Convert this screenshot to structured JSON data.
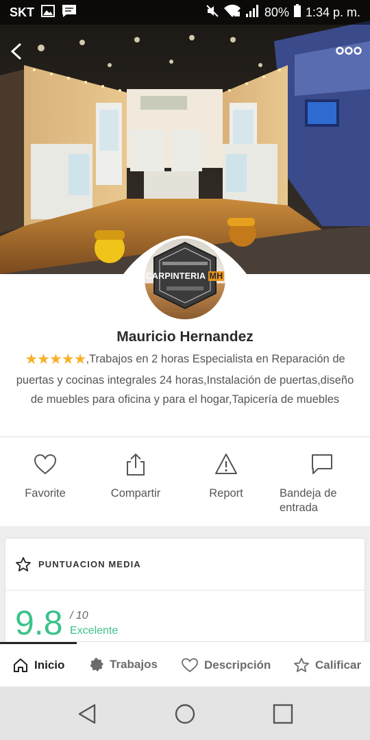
{
  "status_bar": {
    "carrier": "SKT",
    "battery": "80%",
    "time": "1:34 p. m."
  },
  "icons": {
    "back": "chevron-left-icon",
    "more": "more-horizontal-icon",
    "favorite": "heart-icon",
    "share": "share-icon",
    "report": "warning-triangle-icon",
    "inbox": "chat-bubble-icon",
    "rating": "star-outline-icon"
  },
  "avatar": {
    "logo_text": "CARPINTERIA",
    "logo_accent": "MH"
  },
  "profile": {
    "name": "Mauricio Hernandez",
    "rating_stars": 5,
    "description_lead": ",Trabajos en 2 horas Especialista",
    "description_rest": "en Reparación de puertas y cocinas integrales 24 horas,Instalación de puertas,diseño de muebles para oficina y para el hogar,Tapicería de muebles"
  },
  "actions": {
    "favorite": "Favorite",
    "share": "Compartir",
    "report": "Report",
    "inbox_line1": "Bandeja de",
    "inbox_line2": "entrada"
  },
  "rating_card": {
    "title": "PUNTUACION MEDIA",
    "score": "9.8",
    "max": "/ 10",
    "label": "Excelente"
  },
  "tabs": {
    "home": "Inicio",
    "jobs": "Trabajos",
    "description": "Descripción",
    "rate": "Calificar"
  },
  "colors": {
    "accent_green": "#3cc28a",
    "star_yellow": "#f6b12b",
    "logo_orange": "#e8951f"
  }
}
